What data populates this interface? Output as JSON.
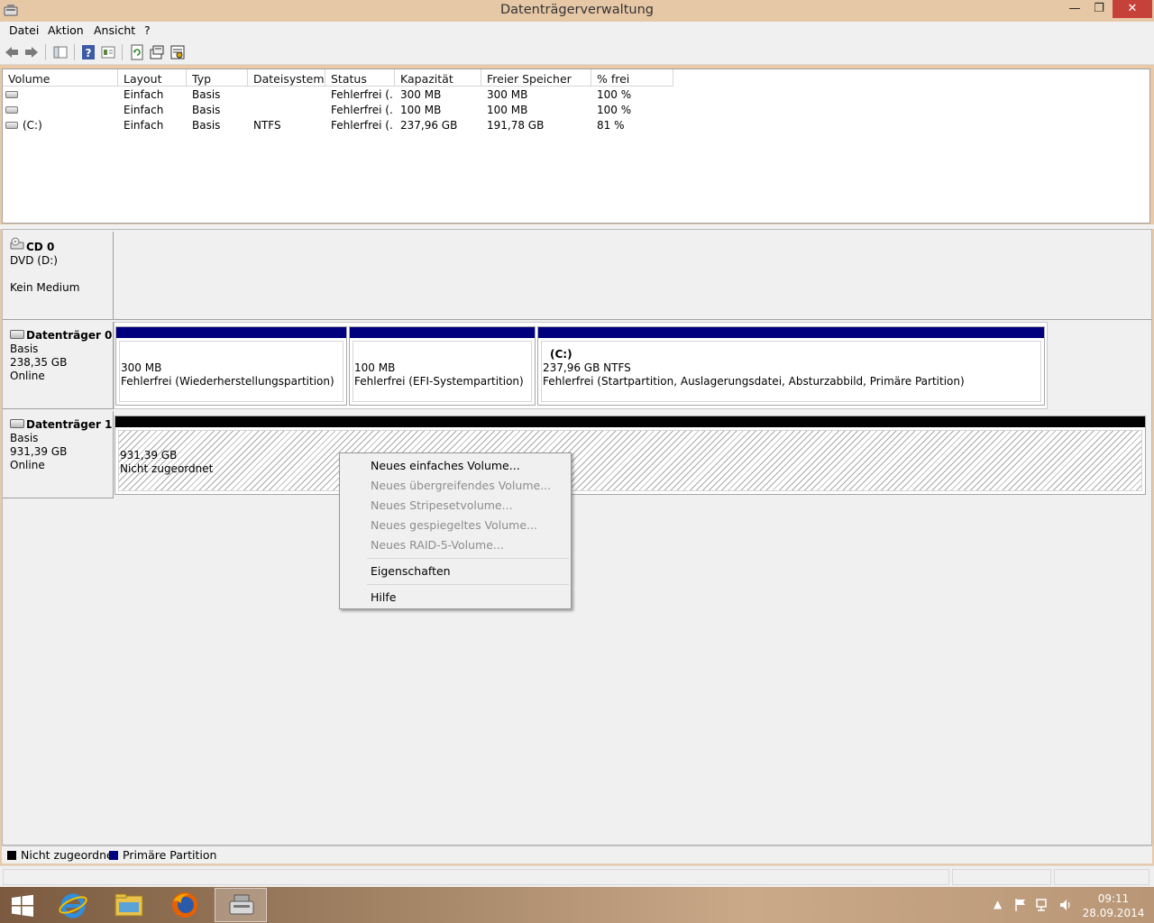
{
  "window": {
    "title": "Datenträgerverwaltung"
  },
  "menu": [
    "Datei",
    "Aktion",
    "Ansicht",
    "?"
  ],
  "columns": [
    "Volume",
    "Layout",
    "Typ",
    "Dateisystem",
    "Status",
    "Kapazität",
    "Freier Speicher",
    "% frei"
  ],
  "volumes": [
    {
      "volume": "",
      "layout": "Einfach",
      "type": "Basis",
      "fs": "",
      "status": "Fehlerfrei (...",
      "capacity": "300 MB",
      "free": "300 MB",
      "pct": "100 %"
    },
    {
      "volume": "",
      "layout": "Einfach",
      "type": "Basis",
      "fs": "",
      "status": "Fehlerfrei (...",
      "capacity": "100 MB",
      "free": "100 MB",
      "pct": "100 %"
    },
    {
      "volume": "(C:)",
      "layout": "Einfach",
      "type": "Basis",
      "fs": "NTFS",
      "status": "Fehlerfrei (...",
      "capacity": "237,96 GB",
      "free": "191,78 GB",
      "pct": "81 %"
    }
  ],
  "disks": {
    "cd0": {
      "name": "CD 0",
      "line1": "DVD (D:)",
      "line3": "Kein Medium"
    },
    "disk0": {
      "name": "Datenträger 0",
      "type": "Basis",
      "size": "238,35 GB",
      "state": "Online",
      "partitions": [
        {
          "title": "",
          "size": "300 MB",
          "status": "Fehlerfrei (Wiederherstellungspartition)"
        },
        {
          "title": "",
          "size": "100 MB",
          "status": "Fehlerfrei (EFI-Systempartition)"
        },
        {
          "title": "(C:)",
          "size": "237,96 GB NTFS",
          "status": "Fehlerfrei (Startpartition, Auslagerungsdatei, Absturzabbild, Primäre Partition)"
        }
      ]
    },
    "disk1": {
      "name": "Datenträger 1",
      "type": "Basis",
      "size": "931,39 GB",
      "state": "Online",
      "unallocated": {
        "size": "931,39 GB",
        "label": "Nicht zugeordnet"
      }
    }
  },
  "legend": [
    {
      "label": "Nicht zugeordnet",
      "color": "#000000"
    },
    {
      "label": "Primäre Partition",
      "color": "#00007f"
    }
  ],
  "context_menu": {
    "items": [
      {
        "label": "Neues einfaches Volume...",
        "enabled": true
      },
      {
        "label": "Neues übergreifendes Volume...",
        "enabled": false
      },
      {
        "label": "Neues Stripesetvolume...",
        "enabled": false
      },
      {
        "label": "Neues gespiegeltes Volume...",
        "enabled": false
      },
      {
        "label": "Neues RAID-5-Volume...",
        "enabled": false
      },
      {
        "label": "Eigenschaften",
        "enabled": true
      },
      {
        "label": "Hilfe",
        "enabled": true
      }
    ]
  },
  "taskbar": {
    "time": "09:11",
    "date": "28.09.2014"
  },
  "colors": {
    "primary_partition": "#00007f",
    "unallocated": "#000000",
    "titlebar": "#e7c8a6",
    "close_button": "#c7413b"
  },
  "icons": [
    "app-icon",
    "back-arrow-icon",
    "forward-arrow-icon",
    "console-tree-icon",
    "help-icon",
    "properties-icon",
    "refresh-icon",
    "rescan-icon",
    "settings-icon",
    "start-icon",
    "internet-explorer-icon",
    "file-explorer-icon",
    "firefox-icon",
    "disk-management-icon",
    "flag-icon",
    "network-icon",
    "volume-icon"
  ]
}
